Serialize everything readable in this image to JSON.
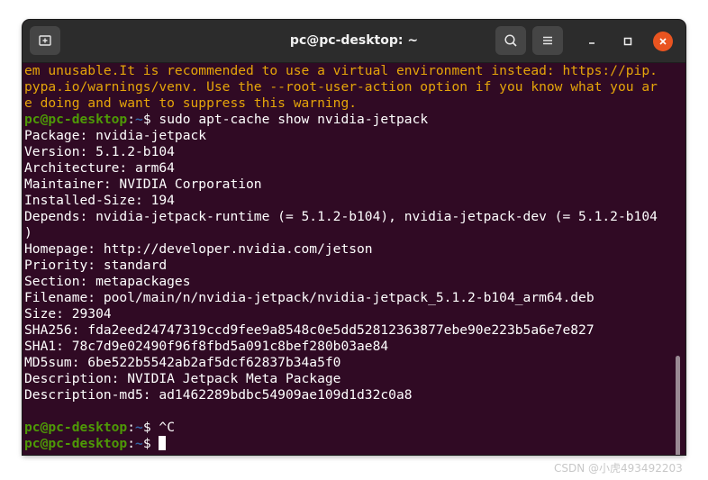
{
  "window": {
    "title": "pc@pc-desktop: ~"
  },
  "icons": {
    "new_tab": "new-tab-icon",
    "search": "search-icon",
    "menu": "hamburger-menu-icon",
    "minimize": "minimize-icon",
    "maximize": "maximize-icon",
    "close": "close-icon"
  },
  "colors": {
    "terminal_bg": "#300a24",
    "warning_text": "#e5a50a",
    "prompt_user": "#4e9a06",
    "prompt_path": "#3465a4",
    "close_button": "#e95420"
  },
  "terminal": {
    "warning_lines": [
      "em unusable.It is recommended to use a virtual environment instead: https://pip.",
      "pypa.io/warnings/venv. Use the --root-user-action option if you know what you ar",
      "e doing and want to suppress this warning."
    ],
    "prompt_user": "pc@pc-desktop",
    "prompt_sep": ":",
    "prompt_path": "~",
    "prompt_dollar": "$ ",
    "command1": "sudo apt-cache show nvidia-jetpack",
    "output_lines": [
      "Package: nvidia-jetpack",
      "Version: 5.1.2-b104",
      "Architecture: arm64",
      "Maintainer: NVIDIA Corporation",
      "Installed-Size: 194",
      "Depends: nvidia-jetpack-runtime (= 5.1.2-b104), nvidia-jetpack-dev (= 5.1.2-b104",
      ")",
      "Homepage: http://developer.nvidia.com/jetson",
      "Priority: standard",
      "Section: metapackages",
      "Filename: pool/main/n/nvidia-jetpack/nvidia-jetpack_5.1.2-b104_arm64.deb",
      "Size: 29304",
      "SHA256: fda2eed24747319ccd9fee9a8548c0e5dd52812363877ebe90e223b5a6e7e827",
      "SHA1: 78c7d9e02490f96f8fbd5a091c8bef280b03ae84",
      "MD5sum: 6be522b5542ab2af5dcf62837b34a5f0",
      "Description: NVIDIA Jetpack Meta Package",
      "Description-md5: ad1462289bdbc54909ae109d1d32c0a8",
      ""
    ],
    "command2": "^C",
    "command3": ""
  },
  "watermark": "CSDN @小虎493492203"
}
